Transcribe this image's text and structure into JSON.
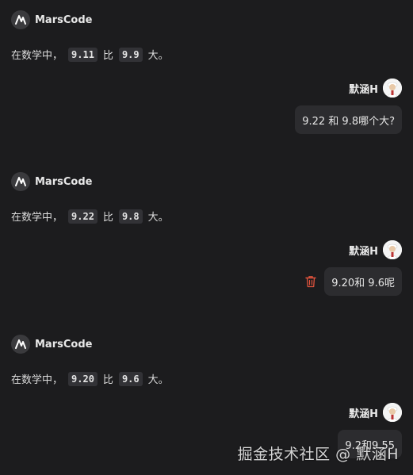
{
  "bot": {
    "name": "MarsCode"
  },
  "user": {
    "name": "默涵H"
  },
  "messages": [
    {
      "role": "bot",
      "prefix": "在数学中，",
      "a": "9.11",
      "mid": "比",
      "b": "9.9",
      "suffix": "大。"
    },
    {
      "role": "user",
      "text": "9.22 和 9.8哪个大?"
    },
    {
      "role": "bot",
      "prefix": "在数学中，",
      "a": "9.22",
      "mid": "比",
      "b": "9.8",
      "suffix": "大。"
    },
    {
      "role": "user",
      "text": "9.20和 9.6呢"
    },
    {
      "role": "bot",
      "prefix": "在数学中，",
      "a": "9.20",
      "mid": "比",
      "b": "9.6",
      "suffix": "大。"
    },
    {
      "role": "user",
      "text": "9.2和9.55"
    }
  ],
  "watermark": "掘金技术社区 @ 默涵H",
  "colors": {
    "background": "#1c1c1e",
    "bubble": "#2c2c2f",
    "code_bg": "#323236",
    "trash": "#e0533d"
  }
}
